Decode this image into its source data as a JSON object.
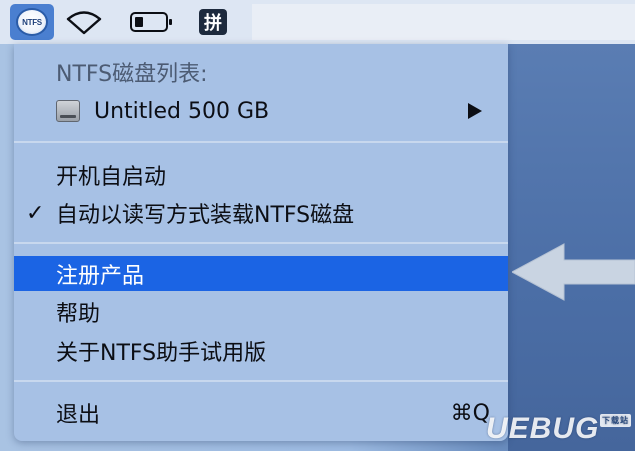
{
  "menubar": {
    "ntfs_logo_text": "NTFS",
    "pinyin_label": "拼",
    "icons": [
      "ntfs-app-icon",
      "wifi-icon",
      "battery-icon",
      "pinyin-input-icon"
    ]
  },
  "menu": {
    "header": "NTFS磁盘列表:",
    "disk": {
      "label": "Untitled  500 GB",
      "icon": "hard-disk-icon",
      "submenu_icon": "triangle-right-icon"
    },
    "launch_at_login": "开机自启动",
    "auto_mount": {
      "label": "自动以读写方式装载NTFS磁盘",
      "checked": true,
      "check_glyph": "✓"
    },
    "register": "注册产品",
    "help": "帮助",
    "about": "关于NTFS助手试用版",
    "quit": {
      "label": "退出",
      "shortcut": "⌘Q"
    }
  },
  "annotation": {
    "icon": "left-arrow-icon"
  },
  "watermark": {
    "text": "UEBUG",
    "sub": "下载站"
  },
  "colors": {
    "highlight": "#1b64e4",
    "menu_bg": "#a7c1e5",
    "menubar_bg": "#dde6f3"
  }
}
